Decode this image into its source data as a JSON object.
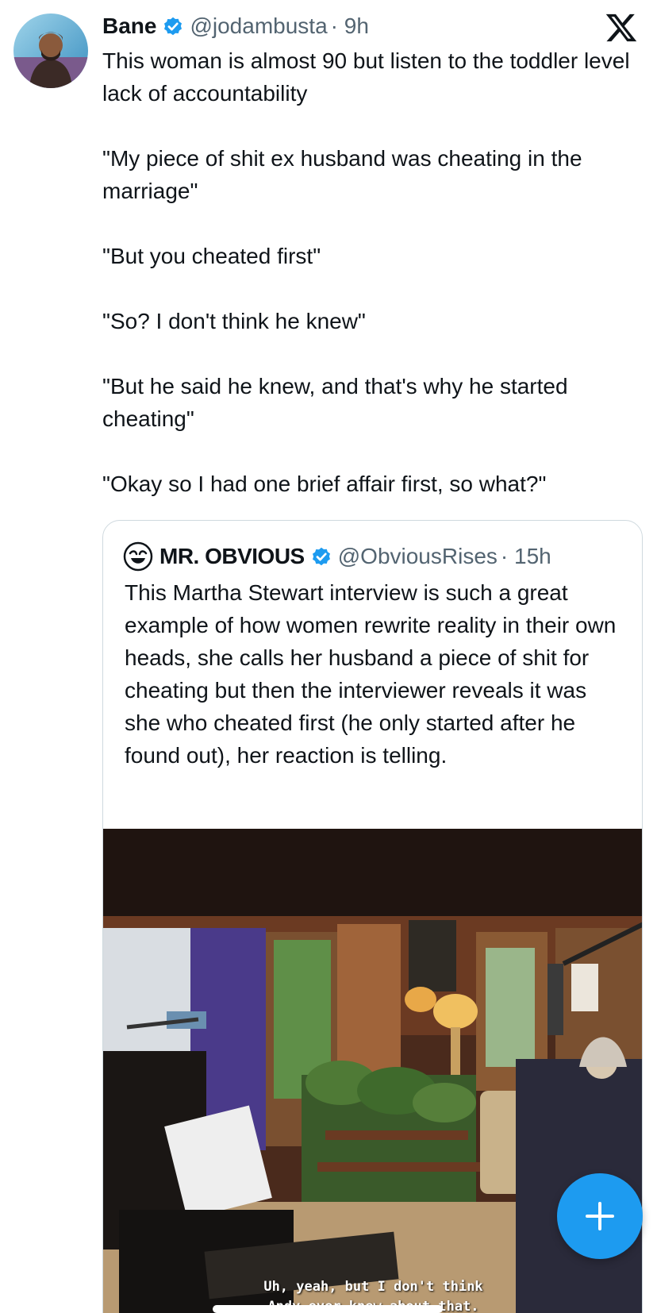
{
  "tweet": {
    "author_name": "Bane",
    "author_handle": "@jodambusta",
    "time": "· 9h",
    "paragraphs": [
      "This woman is almost 90 but listen to the toddler level lack of accountability",
      "\"My piece of shit ex husband was cheating in the marriage\"",
      "\"But you cheated first\"",
      "\"So? I don't think he knew\"",
      "\"But he said he knew, and that's why he started cheating\"",
      "\"Okay so I had one brief affair first, so what?\""
    ]
  },
  "quoted_tweet": {
    "author_name": "MR. OBVIOUS",
    "author_handle": "@ObviousRises",
    "time": "· 15h",
    "text": "This Martha Stewart interview is such a great example of how women rewrite reality in their own heads, she calls her husband a piece of shit for cheating but then the interviewer reveals it was she who cheated first (he only started after he found out), her reaction is telling.",
    "video_caption_line1": "Uh, yeah, but I don't think",
    "video_caption_line2": "Andy ever knew about that."
  },
  "icons": {
    "verified": "verified-badge-icon",
    "x_logo": "x-logo-icon",
    "compose": "plus-icon"
  },
  "colors": {
    "accent": "#1d9bf0",
    "text": "#0f1419",
    "secondary_text": "#536471",
    "border": "#cfd9de"
  }
}
